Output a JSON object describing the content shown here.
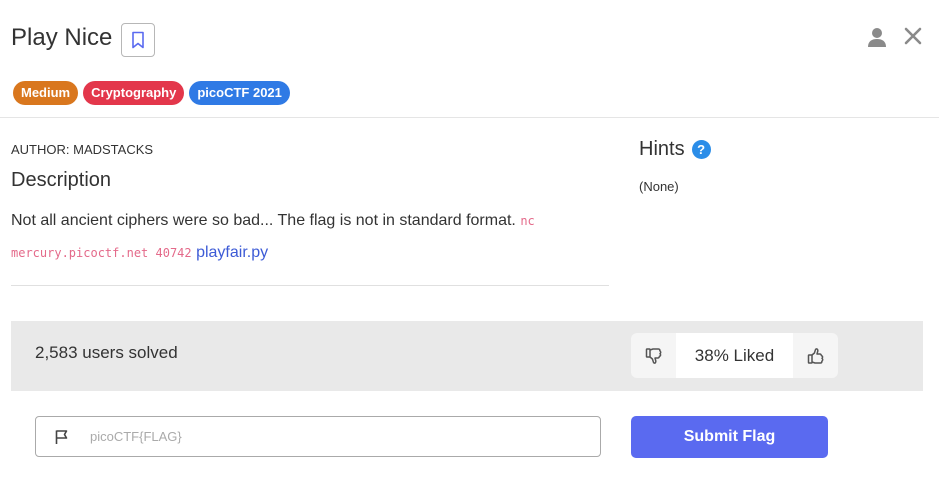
{
  "challenge": {
    "title": "Play Nice",
    "tags": [
      {
        "label": "Medium",
        "color": "#d9771e"
      },
      {
        "label": "Cryptography",
        "color": "#e3374b"
      },
      {
        "label": "picoCTF 2021",
        "color": "#2f7ae5"
      }
    ],
    "author": "AUTHOR: MADSTACKS",
    "description_heading": "Description",
    "description_text": "Not all ancient ciphers were so bad... The flag is not in standard format.",
    "command": "nc mercury.picoctf.net 40742",
    "file_link": "playfair.py"
  },
  "hints": {
    "heading": "Hints",
    "help_symbol": "?",
    "content": "(None)"
  },
  "stats": {
    "solved_text": "2,583 users solved",
    "liked_text": "38% Liked"
  },
  "flag": {
    "placeholder": "picoCTF{FLAG}",
    "submit_label": "Submit Flag"
  },
  "icons": {
    "bookmark": "bookmark-icon",
    "user": "user-icon",
    "close": "close-icon",
    "help": "help-icon",
    "thumbs_down": "thumbs-down-icon",
    "thumbs_up": "thumbs-up-icon",
    "flag": "flag-icon"
  },
  "colors": {
    "accent": "#5a6af0",
    "link": "#3d5bd6",
    "code": "#e46a8a",
    "help": "#2b8de8"
  }
}
